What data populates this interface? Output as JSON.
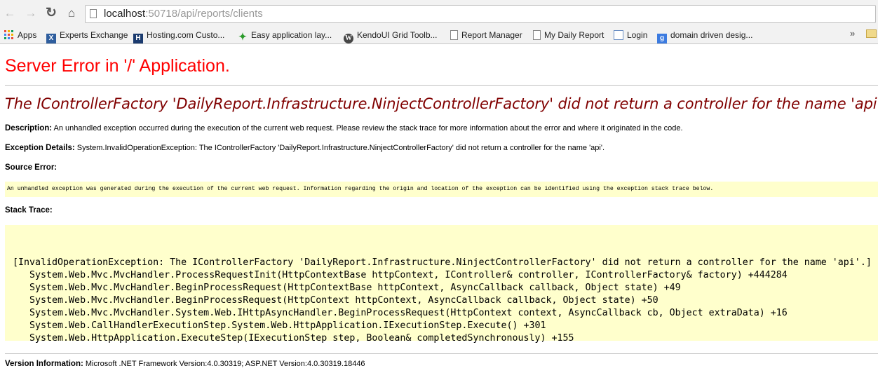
{
  "browser": {
    "url_host": "localhost",
    "url_path": ":50718/api/reports/clients",
    "bookmarks": [
      {
        "label": "Apps",
        "icon": "apps-grid-icon"
      },
      {
        "label": "Experts Exchange",
        "icon": "experts-exchange-icon"
      },
      {
        "label": "Hosting.com Custo...",
        "icon": "hosting-icon"
      },
      {
        "label": "Easy application lay...",
        "icon": "easy-app-icon"
      },
      {
        "label": "KendoUI Grid Toolb...",
        "icon": "wordpress-icon"
      },
      {
        "label": "Report Manager",
        "icon": "document-icon"
      },
      {
        "label": "My Daily Report",
        "icon": "document-icon"
      },
      {
        "label": "Login",
        "icon": "login-page-icon"
      },
      {
        "label": "domain driven desig...",
        "icon": "google-icon"
      }
    ],
    "more_label": "»"
  },
  "page": {
    "title": "Server Error in '/' Application.",
    "error_heading": "The IControllerFactory 'DailyReport.Infrastructure.NinjectControllerFactory' did not return a controller for the name 'api'.",
    "description_label": "Description:",
    "description_text": " An unhandled exception occurred during the execution of the current web request. Please review the stack trace for more information about the error and where it originated in the code.",
    "exception_label": "Exception Details:",
    "exception_text": " System.InvalidOperationException: The IControllerFactory 'DailyReport.Infrastructure.NinjectControllerFactory' did not return a controller for the name 'api'.",
    "source_error_label": "Source Error:",
    "source_error_text": "An unhandled exception was generated during the execution of the current web request. Information regarding the origin and location of the exception can be identified using the exception stack trace below.",
    "stack_trace_label": "Stack Trace:",
    "stack_trace": [
      "[InvalidOperationException: The IControllerFactory 'DailyReport.Infrastructure.NinjectControllerFactory' did not return a controller for the name 'api'.]",
      "   System.Web.Mvc.MvcHandler.ProcessRequestInit(HttpContextBase httpContext, IController& controller, IControllerFactory& factory) +444284",
      "   System.Web.Mvc.MvcHandler.BeginProcessRequest(HttpContextBase httpContext, AsyncCallback callback, Object state) +49",
      "   System.Web.Mvc.MvcHandler.BeginProcessRequest(HttpContext httpContext, AsyncCallback callback, Object state) +50",
      "   System.Web.Mvc.MvcHandler.System.Web.IHttpAsyncHandler.BeginProcessRequest(HttpContext context, AsyncCallback cb, Object extraData) +16",
      "   System.Web.CallHandlerExecutionStep.System.Web.HttpApplication.IExecutionStep.Execute() +301",
      "   System.Web.HttpApplication.ExecuteStep(IExecutionStep step, Boolean& completedSynchronously) +155"
    ],
    "version_label": "Version Information:",
    "version_text": " Microsoft .NET Framework Version:4.0.30319; ASP.NET Version:4.0.30319.18446"
  }
}
